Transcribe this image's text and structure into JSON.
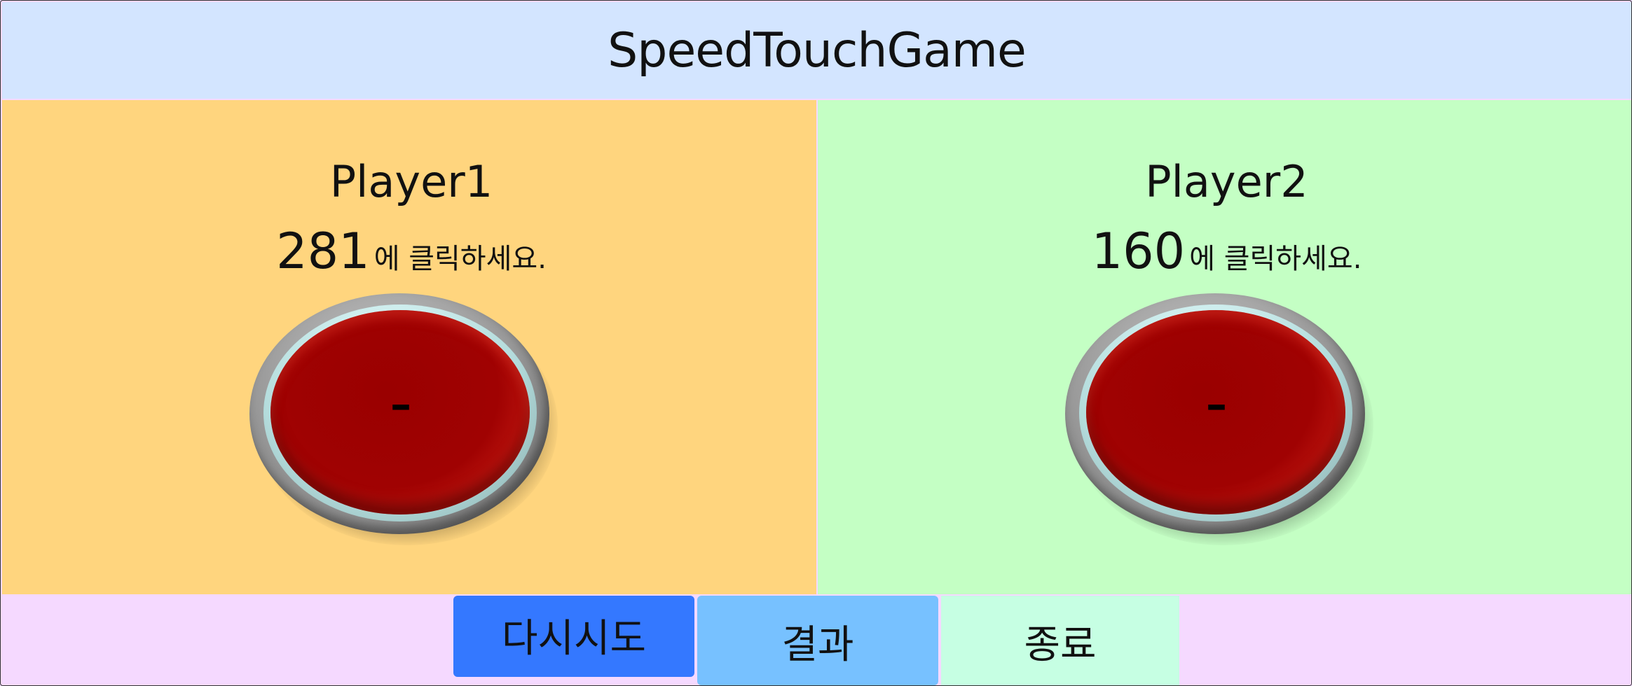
{
  "title": "SpeedTouchGame",
  "players": [
    {
      "name": "Player1",
      "target": "281",
      "instruction": "에 클릭하세요.",
      "button_label": "–",
      "panel_color": "#ffd57e"
    },
    {
      "name": "Player2",
      "target": "160",
      "instruction": "에 클릭하세요.",
      "button_label": "–",
      "panel_color": "#c4ffc4"
    }
  ],
  "buttons": {
    "retry": "다시시도",
    "result": "결과",
    "exit": "종료"
  },
  "colors": {
    "title_bg": "#d3e5ff",
    "bottom_bg": "#f5d9ff",
    "retry_bg": "#3478ff",
    "result_bg": "#77c1ff",
    "exit_bg": "#c6ffe3",
    "button_red": "#a00202"
  }
}
